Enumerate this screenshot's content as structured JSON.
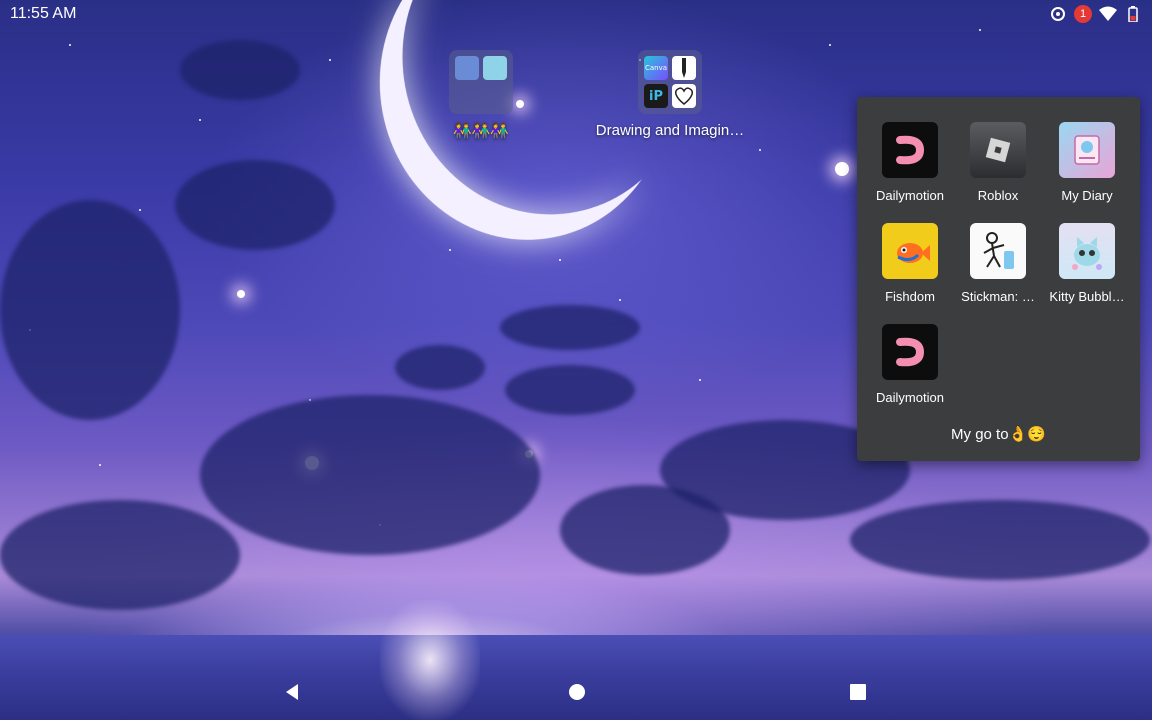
{
  "status_bar": {
    "time": "11:55 AM",
    "notification_count": "1",
    "icons": [
      "sync-icon",
      "notification-badge",
      "wifi-icon",
      "battery-icon"
    ]
  },
  "home": {
    "folder_1": {
      "label": "👫👫👫",
      "icon": "folder-icon"
    },
    "folder_2": {
      "label": "Drawing and Imagin…",
      "icon": "folder-icon",
      "mini_apps": [
        "Canva",
        "pen-app-icon",
        "ibis-paint-icon",
        "heart-drawing-icon"
      ]
    }
  },
  "open_folder": {
    "title": "My go to👌😌",
    "apps": [
      {
        "label": "Dailymotion",
        "icon": "dailymotion-icon"
      },
      {
        "label": "Roblox",
        "icon": "roblox-icon"
      },
      {
        "label": "My Diary",
        "icon": "my-diary-icon"
      },
      {
        "label": "Fishdom",
        "icon": "fishdom-icon"
      },
      {
        "label": "Stickman: …",
        "icon": "stickman-icon"
      },
      {
        "label": "Kitty Bubbl…",
        "icon": "kitty-bubble-icon"
      },
      {
        "label": "Dailymotion",
        "icon": "dailymotion-icon"
      }
    ]
  },
  "nav_bar": {
    "buttons": [
      "back-icon",
      "home-icon",
      "recents-icon"
    ]
  },
  "colors": {
    "panel_bg": "#3b3d3e",
    "dailymotion_pink": "#f48fb1",
    "badge_red": "#e53935"
  }
}
